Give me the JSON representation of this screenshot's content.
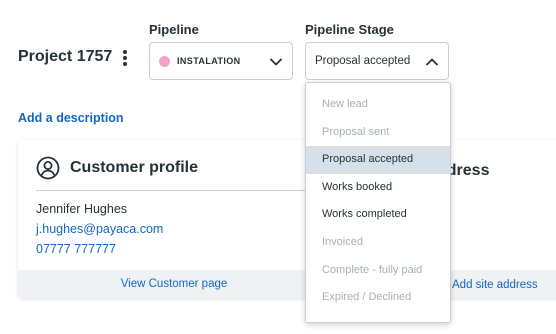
{
  "project": {
    "title": "Project 1757",
    "menu_icon": "kebab-menu-icon"
  },
  "pipeline": {
    "label": "Pipeline",
    "value": "INSTALATION",
    "dot_color": "#f5a3c4",
    "chevron_icon": "chevron-down-icon"
  },
  "pipeline_stage": {
    "label": "Pipeline Stage",
    "value": "Proposal accepted",
    "chevron_icon": "chevron-up-icon",
    "options": [
      {
        "label": "New lead",
        "state": "disabled"
      },
      {
        "label": "Proposal sent",
        "state": "disabled"
      },
      {
        "label": "Proposal accepted",
        "state": "selected"
      },
      {
        "label": "Works booked",
        "state": "enabled"
      },
      {
        "label": "Works completed",
        "state": "enabled"
      },
      {
        "label": "Invoiced",
        "state": "disabled"
      },
      {
        "label": "Complete - fully paid",
        "state": "disabled"
      },
      {
        "label": "Expired / Declined",
        "state": "disabled"
      }
    ]
  },
  "add_description": "Add a description",
  "customer_card": {
    "icon": "user-circle-icon",
    "title": "Customer profile",
    "name": "Jennifer Hughes",
    "email": "j.hughes@payaca.com",
    "phone": "07777 777777",
    "footer_link": "View Customer page"
  },
  "site_card": {
    "title_partial": "ddress",
    "footer_link": "Add site address"
  },
  "colors": {
    "accent_link": "#1467c0",
    "text": "#263238",
    "disabled_text": "#a7b0b6",
    "selected_bg": "#d6e0e8",
    "footer_bg": "#eef2f5"
  }
}
